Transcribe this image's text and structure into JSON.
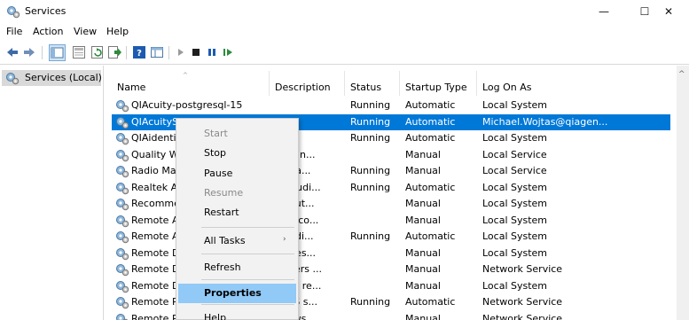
{
  "window": {
    "title": "Services",
    "minimize": "—",
    "maximize": "☐",
    "close": "✕"
  },
  "menu": [
    "File",
    "Action",
    "View",
    "Help"
  ],
  "tree": {
    "root_label": "Services (Local)"
  },
  "columns": [
    "Name",
    "Description",
    "Status",
    "Startup Type",
    "Log On As"
  ],
  "rows": [
    {
      "name": "QIAcuity-postgresql-15",
      "description": "",
      "status": "Running",
      "startup": "Automatic",
      "logon": "Local System",
      "selected": false
    },
    {
      "name": "QIAcuitySuite",
      "description": "",
      "status": "Running",
      "startup": "Automatic",
      "logon": "Michael.Wojtas@qiagen...",
      "selected": true
    },
    {
      "name": "QIAidenti",
      "description": "",
      "status": "Running",
      "startup": "Automatic",
      "logon": "Local System",
      "selected": false
    },
    {
      "name": "Quality W",
      "description": "ty Win...",
      "status": "",
      "startup": "Manual",
      "logon": "Local Service",
      "selected": false
    },
    {
      "name": "Radio Ma",
      "description": "Mana...",
      "status": "Running",
      "startup": "Manual",
      "logon": "Local Service",
      "selected": false
    },
    {
      "name": "Realtek A",
      "description": "ek Audi...",
      "status": "Running",
      "startup": "Automatic",
      "logon": "Local System",
      "selected": false
    },
    {
      "name": "Recomme",
      "description": "es aut...",
      "status": "",
      "startup": "Manual",
      "logon": "Local System",
      "selected": false
    },
    {
      "name": "Remote A",
      "description": "es a co...",
      "status": "",
      "startup": "Manual",
      "logon": "Local System",
      "selected": false
    },
    {
      "name": "Remote A",
      "description": "ges di...",
      "status": "Running",
      "startup": "Automatic",
      "logon": "Local System",
      "selected": false
    },
    {
      "name": "Remote D",
      "description": "te Des...",
      "status": "",
      "startup": "Manual",
      "logon": "Local System",
      "selected": false
    },
    {
      "name": "Remote D",
      "description": "s users ...",
      "status": "",
      "startup": "Manual",
      "logon": "Network Service",
      "selected": false
    },
    {
      "name": "Remote D",
      "description": "s the re...",
      "status": "",
      "startup": "Manual",
      "logon": "Local System",
      "selected": false
    },
    {
      "name": "Remote P",
      "description": "PCSS s...",
      "status": "Running",
      "startup": "Automatic",
      "logon": "Network Service",
      "selected": false
    },
    {
      "name": "Remote P",
      "description": "ndows ...",
      "status": "",
      "startup": "Manual",
      "logon": "Network Service",
      "selected": false
    }
  ],
  "context_menu": [
    {
      "label": "Start",
      "disabled": true
    },
    {
      "label": "Stop",
      "disabled": false
    },
    {
      "label": "Pause",
      "disabled": false
    },
    {
      "label": "Resume",
      "disabled": true
    },
    {
      "label": "Restart",
      "disabled": false
    },
    {
      "label": "All Tasks",
      "disabled": false,
      "submenu": true
    },
    {
      "label": "Refresh",
      "disabled": false
    },
    {
      "label": "Properties",
      "disabled": false,
      "highlighted": true
    },
    {
      "label": "Help",
      "disabled": false
    }
  ],
  "colors": {
    "selection": "#0078d7",
    "menu_highlight": "#91c9f7",
    "tree_selected": "#d9d9d9"
  }
}
